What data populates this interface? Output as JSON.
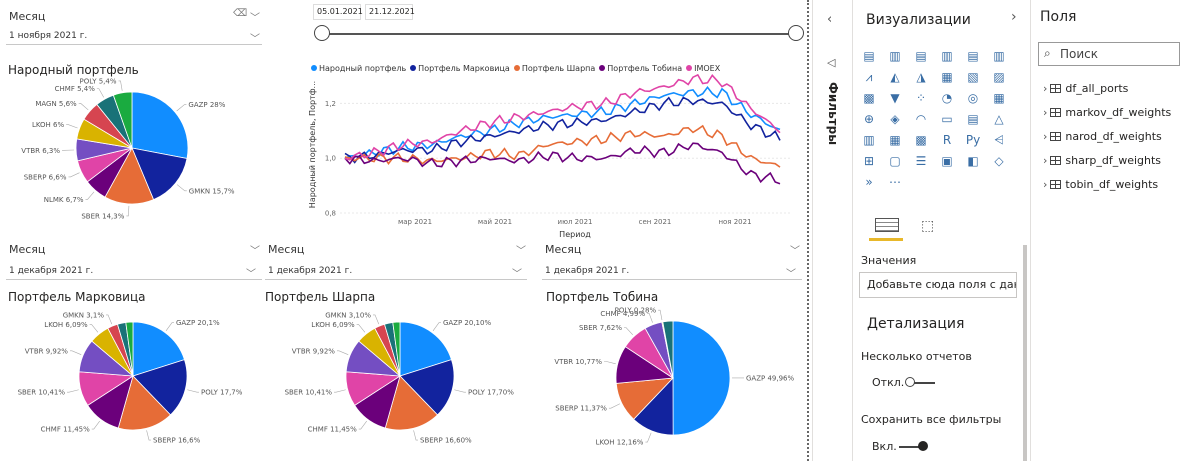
{
  "slicers": {
    "top": {
      "label": "Месяц",
      "value": "1 ноября 2021 г."
    },
    "markowitz": {
      "label": "Месяц",
      "value": "1 декабря 2021 г."
    },
    "sharpe": {
      "label": "Месяц",
      "value": "1 декабря 2021 г."
    },
    "tobin": {
      "label": "Месяц",
      "value": "1 декабря 2021 г."
    }
  },
  "date_range": {
    "start": "05.01.2021",
    "end": "21.12.2021"
  },
  "pies": {
    "narod": {
      "title": "Народный портфель",
      "slices": [
        {
          "label": "GAZP 28%",
          "value": 28,
          "color": "#118DFF"
        },
        {
          "label": "GMKN 15,7%",
          "value": 15.7,
          "color": "#12239E"
        },
        {
          "label": "SBER 14,3%",
          "value": 14.3,
          "color": "#E66C37"
        },
        {
          "label": "NLMK 6,7%",
          "value": 6.7,
          "color": "#6B007B"
        },
        {
          "label": "SBERP 6,6%",
          "value": 6.6,
          "color": "#E044A7"
        },
        {
          "label": "VTBR 6,3%",
          "value": 6.3,
          "color": "#744EC2"
        },
        {
          "label": "LKOH 6%",
          "value": 6,
          "color": "#D9B300"
        },
        {
          "label": "MAGN 5,6%",
          "value": 5.6,
          "color": "#D64550"
        },
        {
          "label": "CHMF 5,4%",
          "value": 5.4,
          "color": "#197278"
        },
        {
          "label": "POLY 5,4%",
          "value": 5.4,
          "color": "#1AAB40"
        }
      ]
    },
    "markowitz": {
      "title": "Портфель Марковица",
      "slices": [
        {
          "label": "GAZP 20,1%",
          "value": 20.1,
          "color": "#118DFF"
        },
        {
          "label": "POLY 17,7%",
          "value": 17.7,
          "color": "#12239E"
        },
        {
          "label": "SBERP 16,6%",
          "value": 16.6,
          "color": "#E66C37"
        },
        {
          "label": "CHMF 11,45%",
          "value": 11.45,
          "color": "#6B007B"
        },
        {
          "label": "SBER 10,41%",
          "value": 10.41,
          "color": "#E044A7"
        },
        {
          "label": "VTBR 9,92%",
          "value": 9.92,
          "color": "#744EC2"
        },
        {
          "label": "LKOH 6,09%",
          "value": 6.09,
          "color": "#D9B300"
        },
        {
          "label": "GMKN 3,1%",
          "value": 3.1,
          "color": "#D64550"
        },
        {
          "label": "",
          "value": 2.5,
          "color": "#197278"
        },
        {
          "label": "",
          "value": 2.13,
          "color": "#1AAB40"
        }
      ]
    },
    "sharpe": {
      "title": "Портфель Шарпа",
      "slices": [
        {
          "label": "GAZP 20,10%",
          "value": 20.1,
          "color": "#118DFF"
        },
        {
          "label": "POLY 17,70%",
          "value": 17.7,
          "color": "#12239E"
        },
        {
          "label": "SBERP 16,60%",
          "value": 16.6,
          "color": "#E66C37"
        },
        {
          "label": "CHMF 11,45%",
          "value": 11.45,
          "color": "#6B007B"
        },
        {
          "label": "SBER 10,41%",
          "value": 10.41,
          "color": "#E044A7"
        },
        {
          "label": "VTBR 9,92%",
          "value": 9.92,
          "color": "#744EC2"
        },
        {
          "label": "LKOH 6,09%",
          "value": 6.09,
          "color": "#D9B300"
        },
        {
          "label": "GMKN 3,10%",
          "value": 3.1,
          "color": "#D64550"
        },
        {
          "label": "",
          "value": 2.5,
          "color": "#197278"
        },
        {
          "label": "",
          "value": 2.13,
          "color": "#1AAB40"
        }
      ]
    },
    "tobin": {
      "title": "Портфель Тобина",
      "slices": [
        {
          "label": "GAZP 49,96%",
          "value": 49.96,
          "color": "#118DFF"
        },
        {
          "label": "LKOH 12,16%",
          "value": 12.16,
          "color": "#12239E"
        },
        {
          "label": "SBERP 11,37%",
          "value": 11.37,
          "color": "#E66C37"
        },
        {
          "label": "VTBR 10,77%",
          "value": 10.77,
          "color": "#6B007B"
        },
        {
          "label": "SBER 7,62%",
          "value": 7.62,
          "color": "#E044A7"
        },
        {
          "label": "CHMF 4,99%",
          "value": 4.99,
          "color": "#744EC2"
        },
        {
          "label": "POLY 0,28%",
          "value": 0.28,
          "color": "#D9B300"
        },
        {
          "label": "",
          "value": 2.85,
          "color": "#197278"
        }
      ]
    }
  },
  "chart_data": {
    "type": "line",
    "xlabel": "Период",
    "ylabel": "Народный портфель, Портф...",
    "x_ticks": [
      "мар 2021",
      "май 2021",
      "июл 2021",
      "сен 2021",
      "ноя 2021"
    ],
    "y_ticks": [
      "0,8",
      "1,0",
      "1,2"
    ],
    "ylim": [
      0.8,
      1.3
    ],
    "legend": [
      "Народный портфель",
      "Портфель Марковица",
      "Портфель Шарпа",
      "Портфель Тобина",
      "IMOEX"
    ],
    "series": [
      {
        "name": "Народный портфель",
        "color": "#118DFF",
        "values": [
          1.0,
          1.02,
          1.04,
          1.05,
          1.08,
          1.1,
          1.13,
          1.15,
          1.16,
          1.17,
          1.2,
          1.23,
          1.24,
          1.24,
          1.16,
          1.1
        ]
      },
      {
        "name": "Портфель Марковица",
        "color": "#12239E",
        "values": [
          1.0,
          1.01,
          1.03,
          1.03,
          1.06,
          1.08,
          1.1,
          1.12,
          1.13,
          1.14,
          1.17,
          1.2,
          1.21,
          1.2,
          1.12,
          1.07
        ]
      },
      {
        "name": "Портфель Шарпа",
        "color": "#E66C37",
        "values": [
          1.0,
          1.0,
          1.0,
          0.99,
          1.0,
          1.02,
          1.01,
          1.05,
          1.06,
          1.07,
          1.09,
          1.08,
          1.11,
          1.08,
          1.0,
          0.97
        ]
      },
      {
        "name": "Портфель Тобина",
        "color": "#6B007B",
        "values": [
          1.0,
          0.99,
          1.0,
          0.98,
          0.99,
          1.0,
          0.99,
          1.01,
          1.0,
          1.0,
          1.03,
          1.02,
          1.05,
          1.02,
          0.94,
          0.92
        ]
      },
      {
        "name": "IMOEX",
        "color": "#E044A7",
        "values": [
          1.0,
          1.02,
          1.05,
          1.06,
          1.1,
          1.13,
          1.15,
          1.17,
          1.19,
          1.2,
          1.24,
          1.26,
          1.29,
          1.28,
          1.18,
          1.1
        ]
      }
    ]
  },
  "filters": {
    "label": "Фильтры"
  },
  "viz": {
    "title": "Визуализации",
    "values_label": "Значения",
    "add_fields": "Добавьте сюда поля с дан...",
    "drill_title": "Детализация",
    "multi_reports": "Несколько отчетов",
    "off": "Откл.",
    "keep_filters": "Сохранить все фильтры",
    "on": "Вкл."
  },
  "fields": {
    "title": "Поля",
    "search_placeholder": "Поиск",
    "tables": [
      "df_all_ports",
      "markov_df_weights",
      "narod_df_weights",
      "sharp_df_weights",
      "tobin_df_weights"
    ]
  }
}
